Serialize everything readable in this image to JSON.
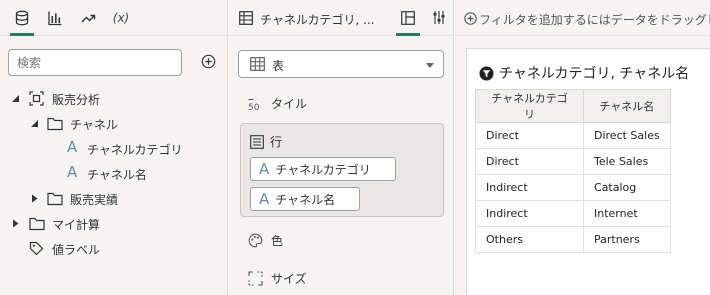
{
  "data_panel": {
    "tabs": [
      {
        "name": "data",
        "icon": "database-icon",
        "active": true
      },
      {
        "name": "visualizations",
        "icon": "bar-chart-icon",
        "active": false
      },
      {
        "name": "analytics",
        "icon": "trend-icon",
        "active": false
      },
      {
        "name": "calculations",
        "label": "(x)",
        "active": false
      }
    ],
    "search": {
      "placeholder": "検索"
    },
    "tree": {
      "sales_analysis": "販売分析",
      "channel": "チャネル",
      "channel_category": "チャネルカテゴリ",
      "channel_name": "チャネル名",
      "sales_results": "販売実績",
      "my_calculations": "マイ計算",
      "value_label": "値ラベル"
    }
  },
  "grammar_panel": {
    "header_title": "チャネルカテゴリ, ...",
    "viz_type": "表",
    "tile_label": "タイル",
    "rows_label": "行",
    "row_chips": [
      "チャネルカテゴリ",
      "チャネル名"
    ],
    "color_label": "色",
    "size_label": "サイズ"
  },
  "canvas": {
    "filter_hint": "フィルタを追加するにはデータをドラッグします",
    "viz_title": "チャネルカテゴリ, チャネル名",
    "table": {
      "headers": [
        "チャネルカテゴリ",
        "チャネル名"
      ],
      "rows": [
        [
          "Direct",
          "Direct Sales"
        ],
        [
          "Direct",
          "Tele Sales"
        ],
        [
          "Indirect",
          "Catalog"
        ],
        [
          "Indirect",
          "Internet"
        ],
        [
          "Others",
          "Partners"
        ]
      ]
    }
  },
  "colors": {
    "accent": "#2a7a62",
    "panel_bg": "#f5f4f2",
    "attribute_icon": "#6a89a8"
  }
}
